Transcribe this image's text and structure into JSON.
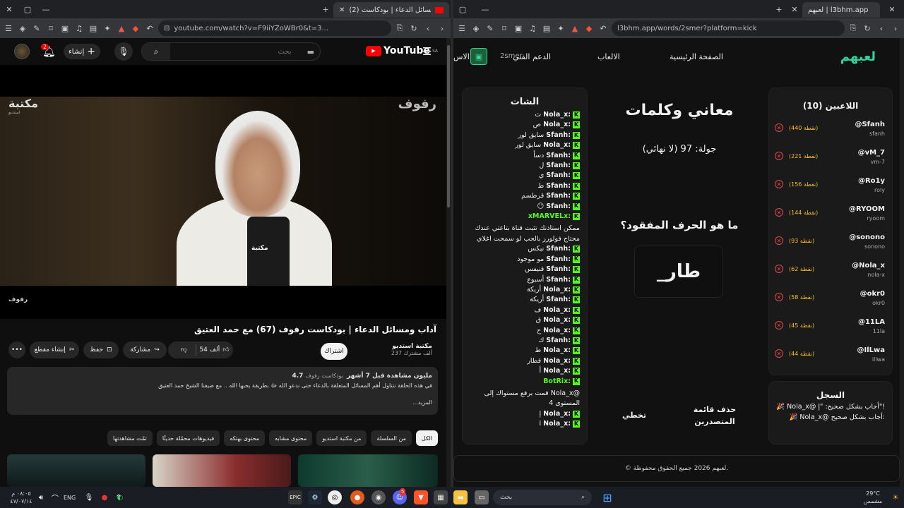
{
  "left": {
    "tab": {
      "title": "(2) آداب ومسائل الدعاء | بودكاست...",
      "new_tab": "+"
    },
    "url": "youtube.com/watch?v=F9iiYZoWBr0&t=3...",
    "header": {
      "notification_count": "2",
      "create_label": "إنشاء",
      "search_placeholder": "بحث",
      "logo_text": "YouTube",
      "logo_region": "SA"
    },
    "player": {
      "watermark_left": "مكتبة",
      "watermark_left_small": "استديو",
      "watermark_right": "رفوف",
      "mic_label": "مكتبة",
      "corner_label": "رفوف"
    },
    "video": {
      "title": "آداب ومسائل الدعاء | بودكاست رفوف (67) مع حمد العتيق",
      "channel_name": "مكتبة استديو",
      "subscribers": "237 ألف مشترك",
      "subscribe_label": "اشتراك",
      "likes": "54 ألف",
      "share_label": "مشاركة",
      "save_label": "حفظ",
      "clip_label": "إنشاء مقطع"
    },
    "description": {
      "meta": "4.7 مليون مشاهدة  قبل 7 أشهر",
      "tag": "بودكاست رفوف",
      "text": "في هذه الحلقة نتناول أهم المسائل المتعلقة بالدعاء حتى ندعو الله ﷻ بطريقة يحبها الله .. مع ضيفنا الشيخ حمد العتيق",
      "more": "...المزيد"
    },
    "chips": [
      "الكل",
      "من السلسلة",
      "من مكتبة استديو",
      "محتوى مشابه",
      "محتوى بهتكه",
      "فيديوهات محمّلة حديثًا",
      "تمّت مشاهدتها"
    ]
  },
  "right": {
    "tab": {
      "title": "لعبهم | l3bhm.app",
      "new_tab": "+"
    },
    "url": "l3bhm.app/words/2smer?platform=kick",
    "nav": {
      "logo": "لعبهم",
      "home": "الصفحة الرئيسية",
      "games": "الالعاب",
      "support": "الدعم الفني",
      "more": "الاس",
      "user": "2smer"
    },
    "chat": {
      "title": "الشات",
      "messages": [
        {
          "user": "Nola_x:",
          "text": "ث"
        },
        {
          "user": "Nola_x:",
          "text": "ص"
        },
        {
          "user": "Sfanh:",
          "text": "سايق لور"
        },
        {
          "user": "Nola_x:",
          "text": "سايق لور"
        },
        {
          "user": "Sfanh:",
          "text": "دسأ"
        },
        {
          "user": "Sfanh:",
          "text": "ل"
        },
        {
          "user": "Sfanh:",
          "text": "ي"
        },
        {
          "user": "Sfanh:",
          "text": "ط"
        },
        {
          "user": "Sfanh:",
          "text": "قرطسم"
        },
        {
          "user": "Sfanh:",
          "text": "😶"
        },
        {
          "user": "xMARVELx:",
          "text": "ممكن استاذنك تثبت قناة بتاعتي عندك محتاج فولورز بالحب لو سمحت اغلاي",
          "long": true
        },
        {
          "user": "Sfanh:",
          "text": "نيكس"
        },
        {
          "user": "Sfanh:",
          "text": "مو موجود"
        },
        {
          "user": "Sfanh:",
          "text": "قنيفس"
        },
        {
          "user": "Sfanh:",
          "text": "أسبوع"
        },
        {
          "user": "Nola_x:",
          "text": "أريكة"
        },
        {
          "user": "Sfanh:",
          "text": "أريكة"
        },
        {
          "user": "Nola_x:",
          "text": "ف"
        },
        {
          "user": "Nola_x:",
          "text": "ق"
        },
        {
          "user": "Nola_x:",
          "text": "ح"
        },
        {
          "user": "Sfanh:",
          "text": "ك"
        },
        {
          "user": "Nola_x:",
          "text": "ط"
        },
        {
          "user": "Nola_x:",
          "text": "قطار"
        },
        {
          "user": "Nola_x:",
          "text": "أ"
        },
        {
          "user": "BotRix:",
          "text": "قمت برفع مستواك إلى Nola_x@ المستوى 4",
          "long": true
        },
        {
          "user": "Nola_x:",
          "text": "إ"
        },
        {
          "user": "Nola_x:",
          "text": "ا"
        }
      ]
    },
    "game": {
      "title": "معاني وكلمات",
      "round": "جولة: 97 (لا نهائي)",
      "question": "ما هو الحرف المفقود؟",
      "word": "_طار",
      "leaderboard_btn": "حذف قائمة المتصدرين",
      "skip_btn": "تخطي"
    },
    "players": {
      "title": "اللاعبين (10)",
      "list": [
        {
          "name": "@Sfanh",
          "handle": "sfanh",
          "score": "(440 نقطة)"
        },
        {
          "name": "@vM_7",
          "handle": "vm-7",
          "score": "(221 نقطة)"
        },
        {
          "name": "@Ro1y",
          "handle": "roly",
          "score": "(156 نقطة)"
        },
        {
          "name": "@RYOOM",
          "handle": "ryoom",
          "score": "(144 نقطة)"
        },
        {
          "name": "@sonono",
          "handle": "sonono",
          "score": "(93 نقطة)"
        },
        {
          "name": "@Nola_x",
          "handle": "nola-x",
          "score": "(62 نقطة)"
        },
        {
          "name": "@okr0",
          "handle": "okr0",
          "score": "(58 نقطة)"
        },
        {
          "name": "@11LA",
          "handle": "11la",
          "score": "(45 نقطة)"
        },
        {
          "name": "@IlLwa",
          "handle": "illwa",
          "score": "(44 نقطة)"
        }
      ]
    },
    "log": {
      "title": "السجل",
      "entries": [
        "🎉 Nola_x@ أجاب بشكل صحيح: \"إ\"!",
        "🎉 Nola_x@ أجاب بشكل صحيح:"
      ]
    },
    "footer": "© لعبهم 2026 جميع الحقوق محفوظة."
  },
  "taskbar": {
    "time": "٠٨:٠٥ م",
    "date": "٤٧/٠٧/١٤",
    "lang": "ENG",
    "search": "بحث",
    "weather_temp": "29°C",
    "weather_text": "مشمس",
    "discord_badge": "5"
  },
  "colors": {
    "accent": "#2ed3a0",
    "kick": "#53fc18",
    "score": "#fbbf24",
    "youtube_red": "#ff0000"
  }
}
